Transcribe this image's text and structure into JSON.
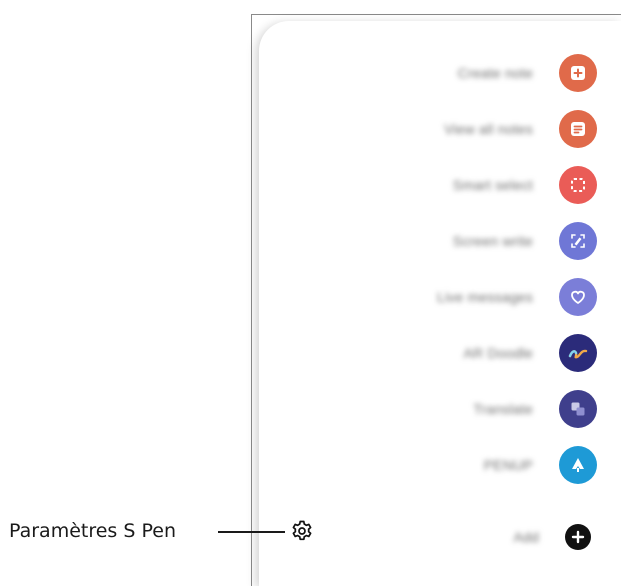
{
  "callout": {
    "label": "Paramètres S Pen"
  },
  "menu": {
    "items": [
      {
        "label": "Create note",
        "icon": "create-note-icon",
        "color": "#e06a4a"
      },
      {
        "label": "View all notes",
        "icon": "view-all-notes-icon",
        "color": "#e06a4a"
      },
      {
        "label": "Smart select",
        "icon": "smart-select-icon",
        "color": "#ea5c57"
      },
      {
        "label": "Screen write",
        "icon": "screen-write-icon",
        "color": "#6f77d6"
      },
      {
        "label": "Live messages",
        "icon": "live-messages-icon",
        "color": "#7b7ed8"
      },
      {
        "label": "AR Doodle",
        "icon": "ar-doodle-icon",
        "color": "#2b2b7a"
      },
      {
        "label": "Translate",
        "icon": "translate-icon",
        "color": "#3f3f8c"
      },
      {
        "label": "PENUP",
        "icon": "penup-icon",
        "color": "#1e9ad6"
      },
      {
        "label": "Add",
        "icon": "add-icon",
        "color": "#111111"
      }
    ]
  }
}
